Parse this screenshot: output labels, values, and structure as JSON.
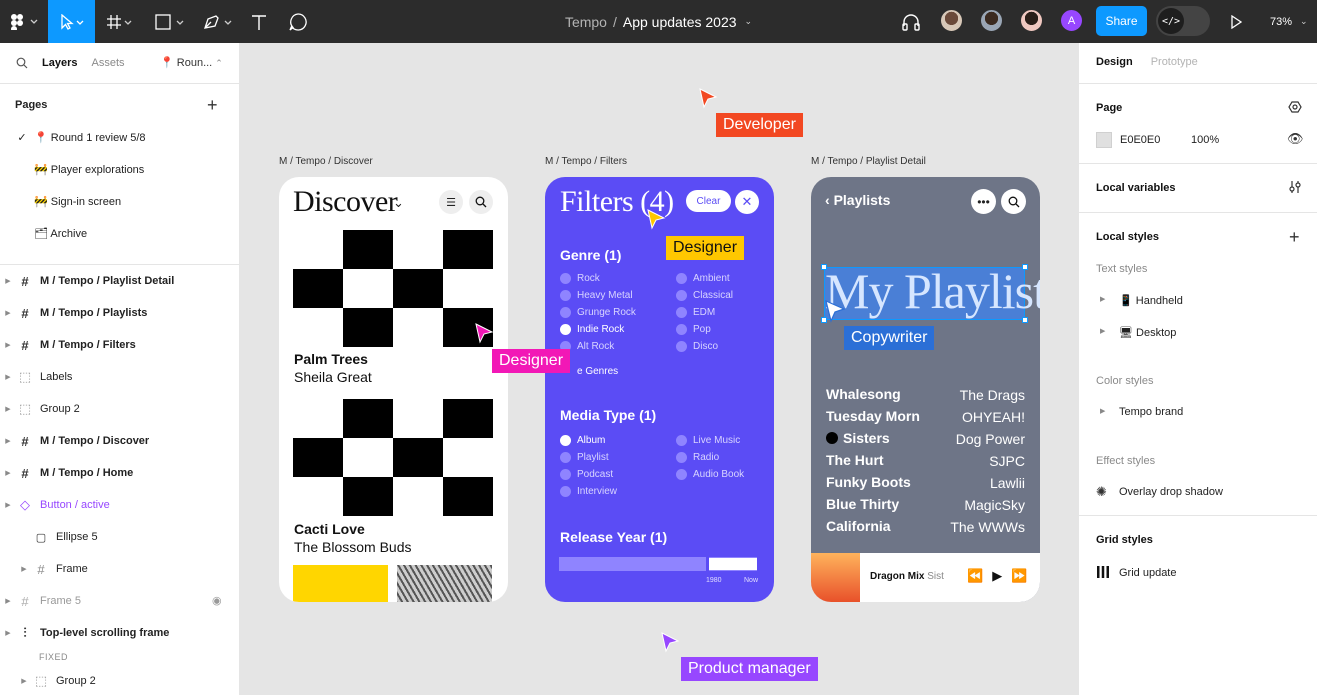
{
  "toolbar": {
    "file_project": "Tempo",
    "file_separator": "/",
    "file_name": "App updates 2023",
    "share_label": "Share",
    "devmode_glyph": "</>",
    "zoom": "73%"
  },
  "left_panel": {
    "tabs": {
      "layers": "Layers",
      "assets": "Assets"
    },
    "current_page_chip": "Roun...",
    "pages_header": "Pages",
    "pages": [
      {
        "label": "📍 Round 1 review 5/8",
        "checked": true
      },
      {
        "label": "🚧 Player explorations",
        "checked": false
      },
      {
        "label": "🚧 Sign-in screen",
        "checked": false
      },
      {
        "label": "🗂 Archive",
        "checked": false
      }
    ],
    "layers": [
      {
        "label": "M / Tempo / Playlist Detail"
      },
      {
        "label": "M / Tempo / Playlists"
      },
      {
        "label": "M / Tempo / Filters"
      },
      {
        "label": "Labels"
      },
      {
        "label": "Group 2"
      },
      {
        "label": "M / Tempo / Discover"
      },
      {
        "label": "M / Tempo / Home"
      },
      {
        "label": "Button / active"
      },
      {
        "label": "Ellipse 5"
      },
      {
        "label": "Frame"
      },
      {
        "label": "Frame 5"
      },
      {
        "label": "Top-level scrolling frame"
      },
      {
        "label": "Group 2"
      }
    ],
    "fixed_label": "FIXED"
  },
  "right_panel": {
    "tabs": {
      "design": "Design",
      "prototype": "Prototype"
    },
    "page_header": "Page",
    "page_color_hex": "E0E0E0",
    "page_color_opacity": "100%",
    "local_variables": "Local variables",
    "local_styles": "Local styles",
    "text_styles_header": "Text styles",
    "text_styles": [
      "📱 Handheld",
      "🖥 Desktop"
    ],
    "color_styles_header": "Color styles",
    "color_styles": [
      "Tempo brand"
    ],
    "effect_styles_header": "Effect styles",
    "effect_styles": [
      "Overlay drop shadow"
    ],
    "grid_styles_header": "Grid styles",
    "grid_styles": [
      "Grid update"
    ]
  },
  "canvas": {
    "frame_labels": {
      "discover": "M / Tempo / Discover",
      "filters": "M / Tempo / Filters",
      "playlist": "M / Tempo / Playlist Detail"
    },
    "discover": {
      "title": "Discover",
      "songs": [
        {
          "title": "Palm Trees",
          "artist": "Sheila Great"
        },
        {
          "title": "Cacti Love",
          "artist": "The Blossom Buds"
        }
      ]
    },
    "filters": {
      "title": "Filters (4)",
      "clear_label": "Clear",
      "genre_header": "Genre (1)",
      "genre_left": [
        {
          "label": "Rock",
          "on": false
        },
        {
          "label": "Heavy Metal",
          "on": false
        },
        {
          "label": "Grunge Rock",
          "on": false
        },
        {
          "label": "Indie Rock",
          "on": true
        },
        {
          "label": "Alt Rock",
          "on": false
        }
      ],
      "genre_right": [
        {
          "label": "Ambient",
          "on": false
        },
        {
          "label": "Classical",
          "on": false
        },
        {
          "label": "EDM",
          "on": false
        },
        {
          "label": "Pop",
          "on": false
        },
        {
          "label": "Disco",
          "on": false
        }
      ],
      "more_genres": "e Genres",
      "media_header": "Media Type (1)",
      "media_left": [
        {
          "label": "Album",
          "on": true
        },
        {
          "label": "Playlist",
          "on": false
        },
        {
          "label": "Podcast",
          "on": false
        },
        {
          "label": "Interview",
          "on": false
        }
      ],
      "media_right": [
        {
          "label": "Live Music",
          "on": false
        },
        {
          "label": "Radio",
          "on": false
        },
        {
          "label": "Audio Book",
          "on": false
        }
      ],
      "year_header": "Release Year (1)",
      "year_min_label": "1980",
      "year_max_label": "Now"
    },
    "playlist": {
      "back_label": "Playlists",
      "title": "My Playlist",
      "tracks": [
        {
          "title": "Whalesong",
          "artist": "The Drags",
          "playing": false
        },
        {
          "title": "Tuesday Morn",
          "artist": "OHYEAH!",
          "playing": false
        },
        {
          "title": "Sisters",
          "artist": "Dog Power",
          "playing": true
        },
        {
          "title": "The Hurt",
          "artist": "SJPC",
          "playing": false
        },
        {
          "title": "Funky Boots",
          "artist": "Lawlii",
          "playing": false
        },
        {
          "title": "Blue Thirty",
          "artist": "MagicSky",
          "playing": false
        },
        {
          "title": "California",
          "artist": "The WWWs",
          "playing": false
        }
      ],
      "now_playing_title": "Dragon Mix",
      "now_playing_artist": "Sist"
    },
    "cursors": [
      {
        "name": "Developer",
        "color": "#f24822"
      },
      {
        "name": "Designer",
        "color": "#ffc700"
      },
      {
        "name": "Designer",
        "color": "#f218b6"
      },
      {
        "name": "Copywriter",
        "color": "#2b6fd6"
      },
      {
        "name": "Product manager",
        "color": "#9747ff"
      }
    ]
  },
  "colors": {
    "accent": "#0d99ff",
    "toolbar_bg": "#2c2c2c",
    "filters_bg": "#5b4cf5",
    "playlist_bg": "#6e7587"
  }
}
